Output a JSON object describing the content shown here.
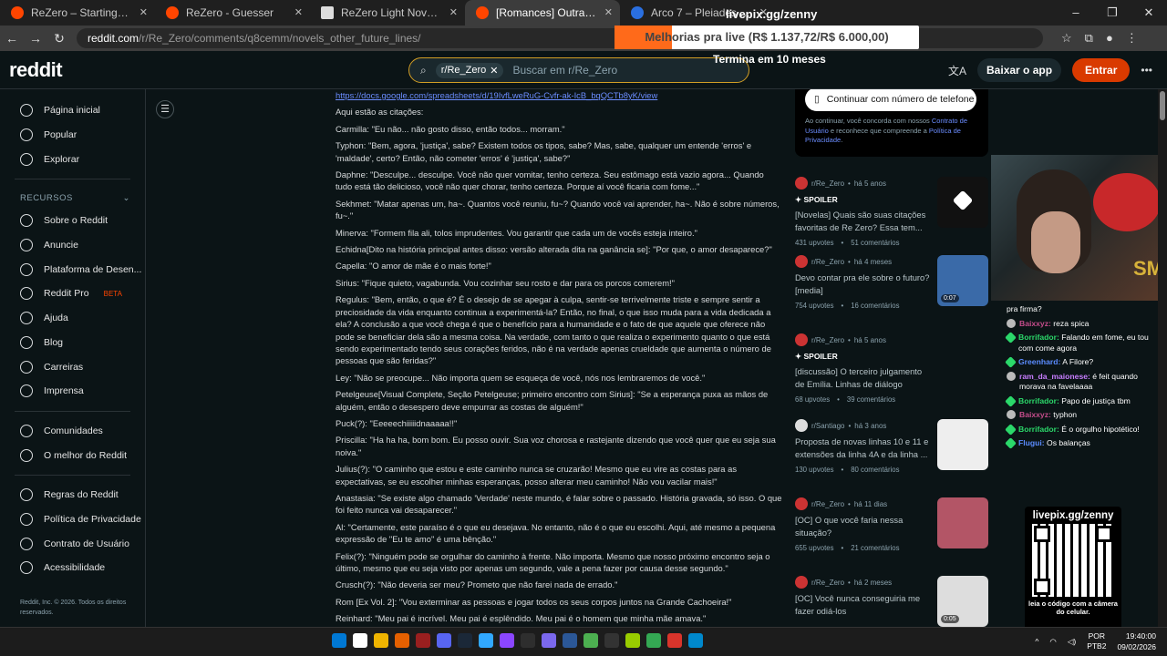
{
  "browser": {
    "tabs": [
      {
        "title": "ReZero – Starting Life in Anoth"
      },
      {
        "title": "ReZero - Guesser"
      },
      {
        "title": "ReZero Light Novel Volume 39"
      },
      {
        "title": "[Romances] Outras Linhas do Fu"
      },
      {
        "title": "Arco 7 – Pleiades Translations"
      }
    ],
    "url_host": "reddit.com",
    "url_path": "/r/Re_Zero/comments/q8cemm/novels_other_future_lines/"
  },
  "overlay": {
    "title": "livepix.gg/zenny",
    "bar_text": "Melhorias pra live (R$ 1.137,72/R$ 6.000,00)",
    "progress": 0.19,
    "subtitle": "Termina em 10 meses"
  },
  "header": {
    "logo": "reddit",
    "subreddit_chip": "r/Re_Zero",
    "search_placeholder": "Buscar em r/Re_Zero",
    "app_button": "Baixar o app",
    "login_button": "Entrar"
  },
  "sidebar": {
    "items_top": [
      {
        "label": "Página inicial",
        "icon": "home-icon"
      },
      {
        "label": "Popular",
        "icon": "popular-icon"
      },
      {
        "label": "Explorar",
        "icon": "explore-icon"
      }
    ],
    "section_label": "RECURSOS",
    "items_resources": [
      {
        "label": "Sobre o Reddit"
      },
      {
        "label": "Anuncie"
      },
      {
        "label": "Plataforma de Desen..."
      },
      {
        "label": "Reddit Pro",
        "badge": "BETA"
      },
      {
        "label": "Ajuda"
      },
      {
        "label": "Blog"
      },
      {
        "label": "Carreiras"
      },
      {
        "label": "Imprensa"
      }
    ],
    "items_community": [
      {
        "label": "Comunidades"
      },
      {
        "label": "O melhor do Reddit"
      }
    ],
    "items_legal": [
      {
        "label": "Regras do Reddit"
      },
      {
        "label": "Política de Privacidade"
      },
      {
        "label": "Contrato de Usuário"
      },
      {
        "label": "Acessibilidade"
      }
    ],
    "footer": "Reddit, Inc. © 2026. Todos os direitos reservados."
  },
  "post": {
    "link": "https://docs.google.com/spreadsheets/d/19IvfLweRuG-Cvfr-ak-IcB_bqQCTb8yK/view",
    "paragraphs": [
      "Aqui estão as citações:",
      "Carmilla: \"Eu não... não gosto disso, então todos... morram.\"",
      "Typhon: \"Bem, agora, 'justiça', sabe? Existem todos os tipos, sabe? Mas, sabe, qualquer um entende 'erros' e 'maldade', certo? Então, não cometer 'erros' é 'justiça', sabe?\"",
      "Daphne: \"Desculpe... desculpe. Você não quer vomitar, tenho certeza. Seu estômago está vazio agora... Quando tudo está tão delicioso, você não quer chorar, tenho certeza. Porque aí você ficaria com fome...\"",
      "Sekhmet: \"Matar apenas um, ha~. Quantos você reuniu, fu~? Quando você vai aprender, ha~. Não é sobre números, fu~.\"",
      "Minerva: \"Formem fila ali, tolos imprudentes. Vou garantir que cada um de vocês esteja inteiro.\"",
      "Echidna[Dito na história principal antes disso: versão alterada dita na ganância se]: \"Por que, o amor desaparece?\"",
      "Capella: \"O amor de mãe é o mais forte!\"",
      "Sirius: \"Fique quieto, vagabunda. Vou cozinhar seu rosto e dar para os porcos comerem!\"",
      "Regulus: \"Bem, então, o que é? É o desejo de se apegar à culpa, sentir-se terrivelmente triste e sempre sentir a preciosidade da vida enquanto continua a experimentá-la? Então, no final, o que isso muda para a vida dedicada a ela? A conclusão a que você chega é que o benefício para a humanidade e o fato de que aquele que oferece não pode se beneficiar dela são a mesma coisa. Na verdade, com tanto o que realiza o experimento quanto o que está sendo experimentado tendo seus corações feridos, não é na verdade apenas crueldade que aumenta o número de pessoas que são feridas?\"",
      "Ley: \"Não se preocupe... Não importa quem se esqueça de você, nós nos lembraremos de você.\"",
      "Petelgeuse[Visual Complete, Seção Petelgeuse; primeiro encontro com Sirius]: \"Se a esperança puxa as mãos de alguém, então o desespero deve empurrar as costas de alguém!\"",
      "Puck(?): \"Eeeeechiiiiidnaaaaa!!\"",
      "Priscilla: \"Ha ha ha, bom bom. Eu posso ouvir. Sua voz chorosa e rastejante dizendo que você quer que eu seja sua noiva.\"",
      "Julius(?): \"O caminho que estou e este caminho nunca se cruzarão! Mesmo que eu vire as costas para as expectativas, se eu escolher minhas esperanças, posso alterar meu caminho! Não vou vacilar mais!\"",
      "Anastasia: \"Se existe algo chamado 'Verdade' neste mundo, é falar sobre o passado. História gravada, só isso. O que foi feito nunca vai desaparecer.\"",
      "Al: \"Certamente, este paraíso é o que eu desejava. No entanto, não é o que eu escolhi. Aqui, até mesmo a pequena expressão de \"Eu te amo\" é uma bênção.\"",
      "Felix(?): \"Ninguém pode se orgulhar do caminho à frente. Não importa. Mesmo que nosso próximo encontro seja o último, mesmo que eu seja visto por apenas um segundo, vale a pena fazer por causa desse segundo.\"",
      "Crusch(?): \"Não deveria ser meu? Prometo que não farei nada de errado.\"",
      "Rom [Ex Vol. 2]: \"Vou exterminar as pessoas e jogar todos os seus corpos juntos na Grande Cachoeira!\"",
      "Reinhard: \"Meu pai é incrível. Meu pai é esplêndido. Meu pai é o homem que minha mãe amava.\""
    ]
  },
  "login_card": {
    "phone_button": "Continuar com número de telefone",
    "consent_pre": "Ao continuar, você concorda com nossos ",
    "consent_link1": "Contrato de Usuário",
    "consent_mid": " e reconhece que compreende a ",
    "consent_link2": "Política de Privacidade",
    "consent_end": "."
  },
  "recommendations": [
    {
      "sub": "r/Re_Zero",
      "age": "há 5 anos",
      "spoiler": "SPOILER",
      "title": "[Novelas] Quais são suas citações favoritas de Re Zero? Essa tem...",
      "upvotes": "431 upvotes",
      "comments": "51 comentários",
      "thumb_color": "#111111"
    },
    {
      "sub": "r/Re_Zero",
      "age": "há 4 meses",
      "spoiler": "",
      "title": "Devo contar pra ele sobre o futuro? [media]",
      "upvotes": "754 upvotes",
      "comments": "16 comentários",
      "thumb_color": "#3a6aa8",
      "duration": "0:07"
    },
    {
      "sub": "r/Re_Zero",
      "age": "há 5 anos",
      "spoiler": "SPOILER",
      "title": "[discussão] O terceiro julgamento de Emília. Linhas de diálogo",
      "upvotes": "68 upvotes",
      "comments": "39 comentários",
      "thumb_color": ""
    },
    {
      "sub": "r/Santiago",
      "age": "há 3 anos",
      "spoiler": "",
      "title": "Proposta de novas linhas 10 e 11 e extensões da linha 4A e da linha ...",
      "upvotes": "130 upvotes",
      "comments": "80 comentários",
      "thumb_color": "#eeeeee"
    },
    {
      "sub": "r/Re_Zero",
      "age": "há 11 dias",
      "spoiler": "",
      "title": "[OC] O que você faria nessa situação?",
      "upvotes": "655 upvotes",
      "comments": "21 comentários",
      "thumb_color": "#b35566"
    },
    {
      "sub": "r/Re_Zero",
      "age": "há 2 meses",
      "spoiler": "",
      "title": "[OC] Você nunca conseguiria me fazer odiá-los",
      "upvotes": "",
      "comments": "",
      "thumb_color": "#dddddd",
      "duration": "0:05"
    }
  ],
  "stream": {
    "cam_text": "SM",
    "chat": [
      {
        "user": "",
        "text": "pra firma?",
        "color": "#ffffff",
        "badge": "none"
      },
      {
        "user": "Baixxyz:",
        "text": "reza spica",
        "color": "#c44c8a",
        "badge": "avatar"
      },
      {
        "user": "Borrifador:",
        "text": "Falando em fome, eu tou com come agora",
        "color": "#2bd86a",
        "badge": "diamond"
      },
      {
        "user": "Greenhard:",
        "text": "A Filore?",
        "color": "#5b8cff",
        "badge": "diamond"
      },
      {
        "user": "ram_da_maionese:",
        "text": "é feit quando morava na favelaaaa",
        "color": "#c77dff",
        "badge": "avatar"
      },
      {
        "user": "Borrifador:",
        "text": "Papo de justiça tbm",
        "color": "#2bd86a",
        "badge": "diamond"
      },
      {
        "user": "Baixxyz:",
        "text": "typhon",
        "color": "#c44c8a",
        "badge": "avatar"
      },
      {
        "user": "Borrifador:",
        "text": "É o orgulho hipotético!",
        "color": "#2bd86a",
        "badge": "diamond"
      },
      {
        "user": "Flugui:",
        "text": "Os balanças",
        "color": "#5b8cff",
        "badge": "diamond"
      }
    ],
    "qr_title": "livepix.gg/zenny",
    "qr_sub": "leia o código com a câmera do celular."
  },
  "taskbar": {
    "lang": "POR",
    "lang2": "PTB2",
    "time": "19:40:00",
    "date": "09/02/2026",
    "apps": [
      "#0078d4",
      "#ffffff",
      "#f0b400",
      "#e66000",
      "#9a1f1f",
      "#5865f2",
      "#1b2838",
      "#31a8ff",
      "#8b46ff",
      "#2e2e2e",
      "#7b68ee",
      "#2b5797",
      "#4caf50",
      "#333333",
      "#99cc00",
      "#34a853",
      "#d9342b",
      "#0088cc"
    ]
  }
}
